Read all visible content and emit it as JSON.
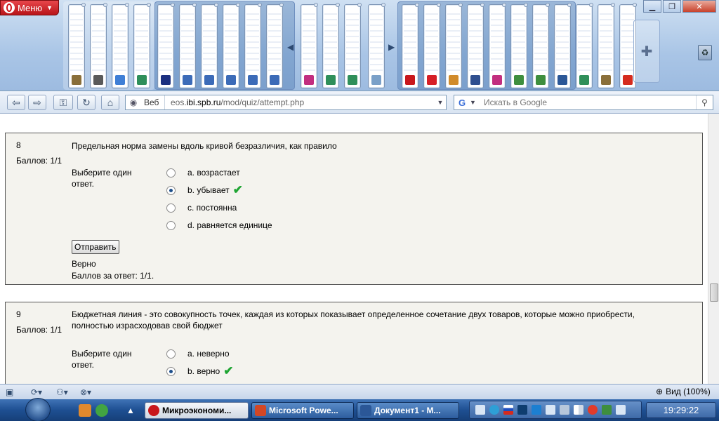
{
  "browser": {
    "menu_label": "Меню",
    "address": {
      "mode_label": "Веб",
      "url_prefix": "eos.",
      "url_host": "ibi.spb.ru",
      "url_path": "/mod/quiz/attempt.php"
    },
    "search": {
      "placeholder": "Искать в Google",
      "engine_glyph": "G"
    }
  },
  "colors": {
    "opera_red": "#c8171c",
    "correct_green": "#1fa533",
    "question_bg": "#f4f3ee"
  },
  "questions": [
    {
      "number": "8",
      "grade": "Баллов: 1/1",
      "text": "Предельная норма замены вдоль кривой безразличия, как правило",
      "prompt": "Выберите один ответ.",
      "options": [
        {
          "label": "a. возрастает",
          "checked": false,
          "correct": false
        },
        {
          "label": "b. убывает",
          "checked": true,
          "correct": true
        },
        {
          "label": "c. постоянна",
          "checked": false,
          "correct": false
        },
        {
          "label": "d. равняется единице",
          "checked": false,
          "correct": false
        }
      ],
      "submit_label": "Отправить",
      "status": "Верно",
      "score": "Баллов за ответ: 1/1."
    },
    {
      "number": "9",
      "grade": "Баллов: 1/1",
      "text": "Бюджетная линия - это совокупность точек, каждая из которых показывает определенное сочетание двух товаров, которые можно приобрести, полностью израсходовав свой бюджет",
      "prompt": "Выберите один ответ.",
      "options": [
        {
          "label": "a. неверно",
          "checked": false,
          "correct": false
        },
        {
          "label": "b. верно",
          "checked": true,
          "correct": true
        }
      ]
    }
  ],
  "statusbar": {
    "zoom": "Вид (100%)"
  },
  "taskbar": {
    "tasks": [
      {
        "label": "Микроэкономи...",
        "active": true,
        "icon_color": "#c8171c"
      },
      {
        "label": "Microsoft Powe...",
        "active": false,
        "icon_color": "#d24726"
      },
      {
        "label": "Документ1 - M...",
        "active": false,
        "icon_color": "#2b5797"
      }
    ],
    "clock": "19:29:22"
  }
}
